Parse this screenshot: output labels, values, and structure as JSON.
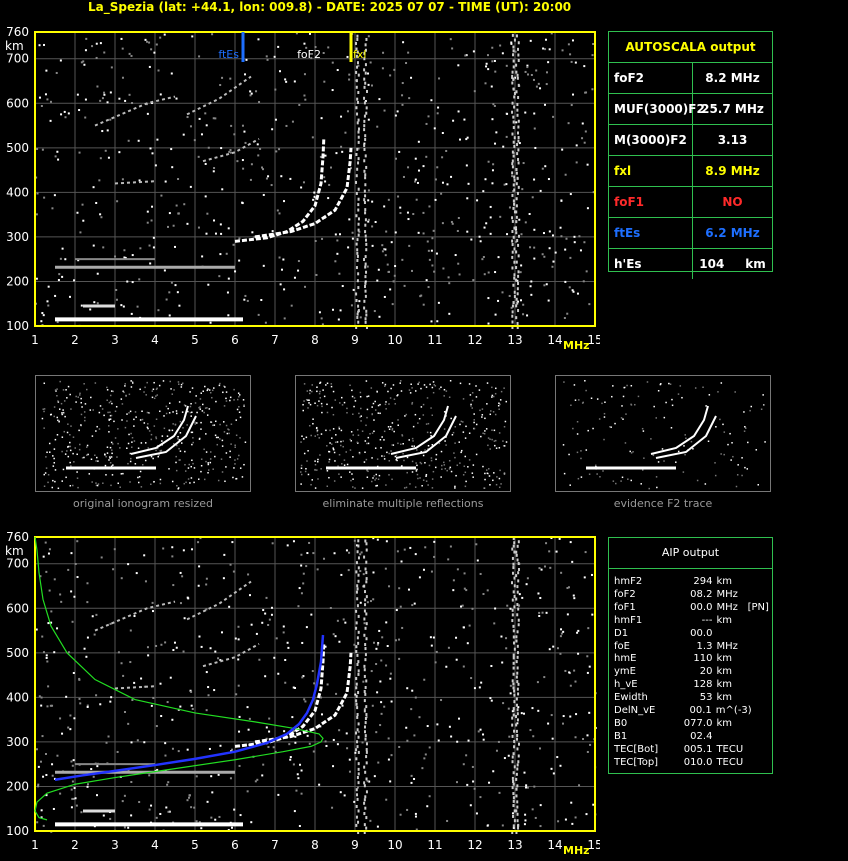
{
  "header": {
    "title": "La_Spezia (lat: +44.1, lon: 009.8) - DATE: 2025 07 07 - TIME (UT): 20:00"
  },
  "colors": {
    "frame": "#ffff00",
    "grid": "#555555",
    "panel_border": "#2fbf4f",
    "ftEs": "#1e6fff",
    "fxl": "#ffff00",
    "foF1": "#ff2a2a",
    "profile": "#22dd22",
    "trace_fit": "#2233ff"
  },
  "chart_data": [
    {
      "type": "scatter",
      "title": "",
      "xlabel": "MHz",
      "ylabel": "km",
      "xlim": [
        1,
        15
      ],
      "ylim": [
        100,
        760
      ],
      "x_ticks": [
        1,
        2,
        3,
        4,
        5,
        6,
        7,
        8,
        9,
        10,
        11,
        12,
        13,
        14,
        15
      ],
      "y_ticks": [
        100,
        200,
        300,
        400,
        500,
        600,
        700,
        760
      ],
      "grid": true,
      "markers": [
        {
          "label": "ftEs",
          "x": 6.2,
          "color": "#1e6fff"
        },
        {
          "label": "foF2",
          "x": 8.2,
          "color": "#ffffff"
        },
        {
          "label": "fxl",
          "x": 8.9,
          "color": "#ffff00"
        }
      ]
    },
    {
      "type": "line",
      "title": "",
      "xlabel": "MHz",
      "ylabel": "km",
      "xlim": [
        1,
        15
      ],
      "ylim": [
        100,
        760
      ],
      "x_ticks": [
        1,
        2,
        3,
        4,
        5,
        6,
        7,
        8,
        9,
        10,
        11,
        12,
        13,
        14,
        15
      ],
      "y_ticks": [
        100,
        200,
        300,
        400,
        500,
        600,
        700,
        760
      ],
      "grid": true,
      "series": [
        {
          "color": "#22dd22",
          "x": [
            1.3,
            1.1,
            1.0,
            1.05,
            1.3,
            2.0,
            3.0,
            4.5,
            6.0,
            7.2,
            7.9,
            8.15,
            8.2,
            8.1,
            7.5,
            6.5,
            5.0,
            3.5,
            2.5,
            1.8,
            1.4,
            1.2,
            1.1,
            1.05,
            1.0
          ],
          "y": [
            125,
            130,
            145,
            165,
            185,
            205,
            220,
            240,
            260,
            278,
            290,
            300,
            308,
            318,
            330,
            345,
            365,
            395,
            440,
            500,
            560,
            620,
            680,
            730,
            760
          ]
        },
        {
          "color": "#2233ff",
          "x": [
            1.5,
            2.2,
            3.0,
            4.0,
            5.0,
            6.0,
            6.8,
            7.3,
            7.6,
            7.8,
            7.95,
            8.05,
            8.15,
            8.2
          ],
          "y": [
            215,
            225,
            235,
            248,
            262,
            278,
            298,
            318,
            340,
            365,
            395,
            430,
            480,
            540
          ]
        }
      ]
    }
  ],
  "thumbnails": [
    {
      "caption": "original ionogram resized"
    },
    {
      "caption": "eliminate multiple reflections"
    },
    {
      "caption": "evidence F2 trace"
    }
  ],
  "autoscala": {
    "title": "AUTOSCALA output",
    "rows": [
      {
        "label": "foF2",
        "value": "8.2 MHz",
        "color": "#ffffff"
      },
      {
        "label": "MUF(3000)F2",
        "value": "25.7 MHz",
        "color": "#ffffff"
      },
      {
        "label": "M(3000)F2",
        "value": "3.13",
        "color": "#ffffff"
      },
      {
        "label": "fxl",
        "value": "8.9 MHz",
        "color": "#ffff00"
      },
      {
        "label": "foF1",
        "value": "NO",
        "color": "#ff2a2a"
      },
      {
        "label": "ftEs",
        "value": "6.2 MHz",
        "color": "#1e6fff"
      },
      {
        "label": "h'Es",
        "value": "104",
        "unit": "km",
        "color": "#ffffff"
      }
    ]
  },
  "aip": {
    "title": "AIP output",
    "rows": [
      {
        "name": "hmF2",
        "value": "294",
        "unit": "km",
        "extra": ""
      },
      {
        "name": "foF2",
        "value": "08.2",
        "unit": "MHz",
        "extra": ""
      },
      {
        "name": "foF1",
        "value": "00.0",
        "unit": "MHz",
        "extra": "[PN]"
      },
      {
        "name": "hmF1",
        "value": "---",
        "unit": "km",
        "extra": ""
      },
      {
        "name": "D1",
        "value": "00.0",
        "unit": "",
        "extra": ""
      },
      {
        "name": "foE",
        "value": "1.3",
        "unit": "MHz",
        "extra": ""
      },
      {
        "name": "hmE",
        "value": "110",
        "unit": "km",
        "extra": ""
      },
      {
        "name": "ymE",
        "value": "20",
        "unit": "km",
        "extra": ""
      },
      {
        "name": "h_vE",
        "value": "128",
        "unit": "km",
        "extra": ""
      },
      {
        "name": "Ewidth",
        "value": "53",
        "unit": "km",
        "extra": ""
      },
      {
        "name": "DelN_vE",
        "value": "00.1",
        "unit": "m^(-3)",
        "extra": ""
      },
      {
        "name": "B0",
        "value": "077.0",
        "unit": "km",
        "extra": ""
      },
      {
        "name": "B1",
        "value": "02.4",
        "unit": "",
        "extra": ""
      },
      {
        "name": "TEC[Bot]",
        "value": "005.1",
        "unit": "TECU",
        "extra": ""
      },
      {
        "name": "TEC[Top]",
        "value": "010.0",
        "unit": "TECU",
        "extra": ""
      }
    ]
  }
}
